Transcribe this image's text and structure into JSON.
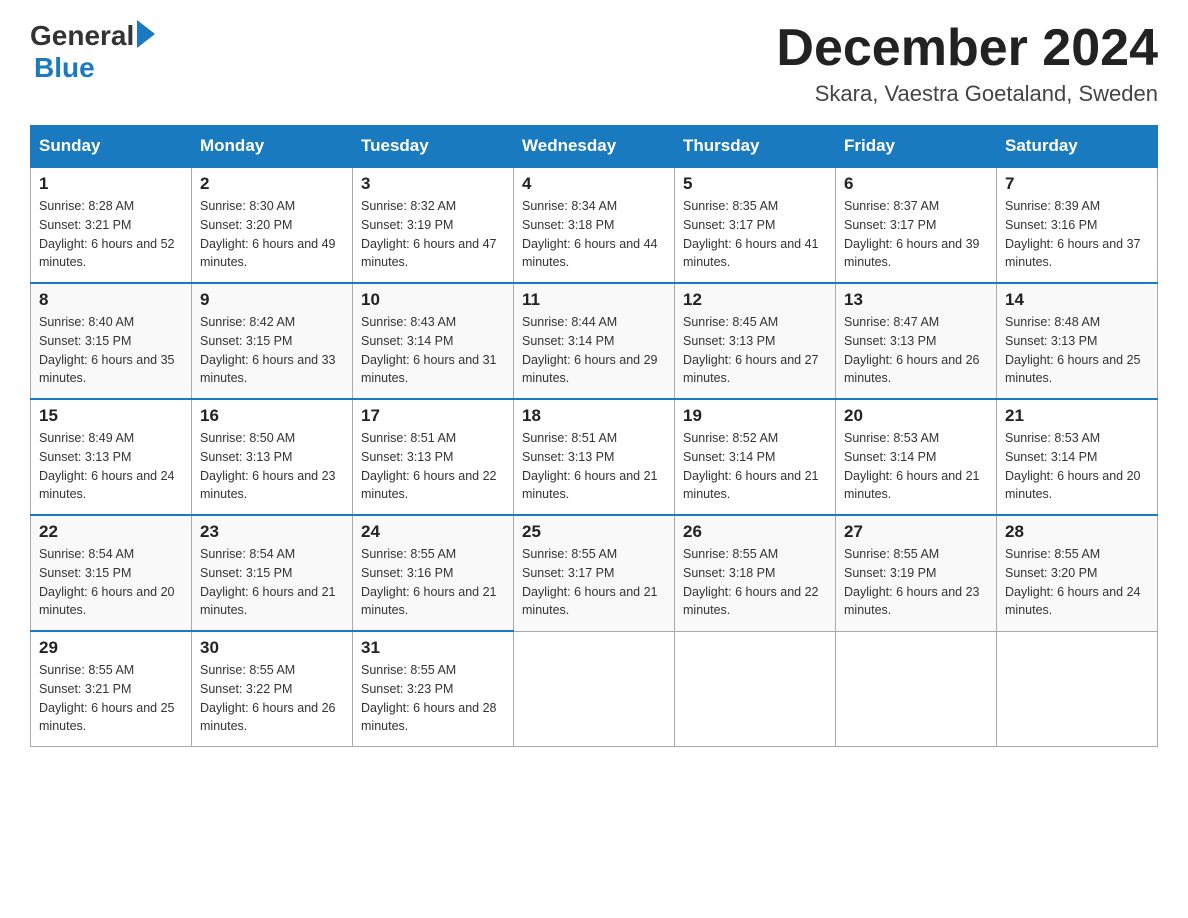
{
  "header": {
    "logo_general": "General",
    "logo_blue": "Blue",
    "month_title": "December 2024",
    "location": "Skara, Vaestra Goetaland, Sweden"
  },
  "days_of_week": [
    "Sunday",
    "Monday",
    "Tuesday",
    "Wednesday",
    "Thursday",
    "Friday",
    "Saturday"
  ],
  "weeks": [
    [
      {
        "num": "1",
        "sunrise": "8:28 AM",
        "sunset": "3:21 PM",
        "daylight": "6 hours and 52 minutes."
      },
      {
        "num": "2",
        "sunrise": "8:30 AM",
        "sunset": "3:20 PM",
        "daylight": "6 hours and 49 minutes."
      },
      {
        "num": "3",
        "sunrise": "8:32 AM",
        "sunset": "3:19 PM",
        "daylight": "6 hours and 47 minutes."
      },
      {
        "num": "4",
        "sunrise": "8:34 AM",
        "sunset": "3:18 PM",
        "daylight": "6 hours and 44 minutes."
      },
      {
        "num": "5",
        "sunrise": "8:35 AM",
        "sunset": "3:17 PM",
        "daylight": "6 hours and 41 minutes."
      },
      {
        "num": "6",
        "sunrise": "8:37 AM",
        "sunset": "3:17 PM",
        "daylight": "6 hours and 39 minutes."
      },
      {
        "num": "7",
        "sunrise": "8:39 AM",
        "sunset": "3:16 PM",
        "daylight": "6 hours and 37 minutes."
      }
    ],
    [
      {
        "num": "8",
        "sunrise": "8:40 AM",
        "sunset": "3:15 PM",
        "daylight": "6 hours and 35 minutes."
      },
      {
        "num": "9",
        "sunrise": "8:42 AM",
        "sunset": "3:15 PM",
        "daylight": "6 hours and 33 minutes."
      },
      {
        "num": "10",
        "sunrise": "8:43 AM",
        "sunset": "3:14 PM",
        "daylight": "6 hours and 31 minutes."
      },
      {
        "num": "11",
        "sunrise": "8:44 AM",
        "sunset": "3:14 PM",
        "daylight": "6 hours and 29 minutes."
      },
      {
        "num": "12",
        "sunrise": "8:45 AM",
        "sunset": "3:13 PM",
        "daylight": "6 hours and 27 minutes."
      },
      {
        "num": "13",
        "sunrise": "8:47 AM",
        "sunset": "3:13 PM",
        "daylight": "6 hours and 26 minutes."
      },
      {
        "num": "14",
        "sunrise": "8:48 AM",
        "sunset": "3:13 PM",
        "daylight": "6 hours and 25 minutes."
      }
    ],
    [
      {
        "num": "15",
        "sunrise": "8:49 AM",
        "sunset": "3:13 PM",
        "daylight": "6 hours and 24 minutes."
      },
      {
        "num": "16",
        "sunrise": "8:50 AM",
        "sunset": "3:13 PM",
        "daylight": "6 hours and 23 minutes."
      },
      {
        "num": "17",
        "sunrise": "8:51 AM",
        "sunset": "3:13 PM",
        "daylight": "6 hours and 22 minutes."
      },
      {
        "num": "18",
        "sunrise": "8:51 AM",
        "sunset": "3:13 PM",
        "daylight": "6 hours and 21 minutes."
      },
      {
        "num": "19",
        "sunrise": "8:52 AM",
        "sunset": "3:14 PM",
        "daylight": "6 hours and 21 minutes."
      },
      {
        "num": "20",
        "sunrise": "8:53 AM",
        "sunset": "3:14 PM",
        "daylight": "6 hours and 21 minutes."
      },
      {
        "num": "21",
        "sunrise": "8:53 AM",
        "sunset": "3:14 PM",
        "daylight": "6 hours and 20 minutes."
      }
    ],
    [
      {
        "num": "22",
        "sunrise": "8:54 AM",
        "sunset": "3:15 PM",
        "daylight": "6 hours and 20 minutes."
      },
      {
        "num": "23",
        "sunrise": "8:54 AM",
        "sunset": "3:15 PM",
        "daylight": "6 hours and 21 minutes."
      },
      {
        "num": "24",
        "sunrise": "8:55 AM",
        "sunset": "3:16 PM",
        "daylight": "6 hours and 21 minutes."
      },
      {
        "num": "25",
        "sunrise": "8:55 AM",
        "sunset": "3:17 PM",
        "daylight": "6 hours and 21 minutes."
      },
      {
        "num": "26",
        "sunrise": "8:55 AM",
        "sunset": "3:18 PM",
        "daylight": "6 hours and 22 minutes."
      },
      {
        "num": "27",
        "sunrise": "8:55 AM",
        "sunset": "3:19 PM",
        "daylight": "6 hours and 23 minutes."
      },
      {
        "num": "28",
        "sunrise": "8:55 AM",
        "sunset": "3:20 PM",
        "daylight": "6 hours and 24 minutes."
      }
    ],
    [
      {
        "num": "29",
        "sunrise": "8:55 AM",
        "sunset": "3:21 PM",
        "daylight": "6 hours and 25 minutes."
      },
      {
        "num": "30",
        "sunrise": "8:55 AM",
        "sunset": "3:22 PM",
        "daylight": "6 hours and 26 minutes."
      },
      {
        "num": "31",
        "sunrise": "8:55 AM",
        "sunset": "3:23 PM",
        "daylight": "6 hours and 28 minutes."
      },
      null,
      null,
      null,
      null
    ]
  ]
}
